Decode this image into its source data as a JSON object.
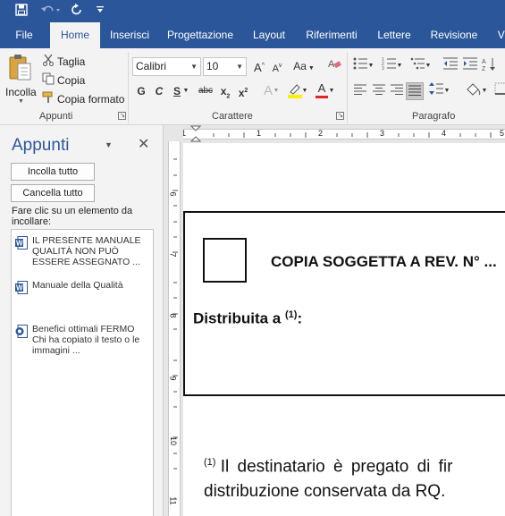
{
  "quick_access": {
    "save_icon": "save-icon",
    "undo_icon": "undo-icon",
    "redo_icon": "redo-icon",
    "customize_icon": "customize-icon"
  },
  "tabs": [
    {
      "label": "File"
    },
    {
      "label": "Home"
    },
    {
      "label": "Inserisci"
    },
    {
      "label": "Progettazione"
    },
    {
      "label": "Layout"
    },
    {
      "label": "Riferimenti"
    },
    {
      "label": "Lettere"
    },
    {
      "label": "Revisione"
    },
    {
      "label": "Vi"
    }
  ],
  "ribbon": {
    "clipboard": {
      "paste": "Incolla",
      "cut": "Taglia",
      "copy": "Copia",
      "format_painter": "Copia formato",
      "group_label": "Appunti"
    },
    "font": {
      "font_name": "Calibri",
      "font_size": "10",
      "grow": "A",
      "shrink": "A",
      "case": "Aa",
      "bold": "G",
      "italic": "C",
      "underline": "S",
      "strike": "abc",
      "subscript": "x",
      "subscript_mark": "2",
      "superscript": "x",
      "superscript_mark": "2",
      "effects": "A",
      "font_color": "A",
      "group_label": "Carattere"
    },
    "paragraph": {
      "group_label": "Paragrafo"
    }
  },
  "pane": {
    "title": "Appunti",
    "paste_all": "Incolla tutto",
    "clear_all": "Cancella tutto",
    "hint": "Fare clic su un elemento da incollare:",
    "items": [
      {
        "text": "IL PRESENTE MANUALE QUALITÀ NON PUÒ ESSERE ASSEGNATO ...",
        "icon": "word-doc-icon"
      },
      {
        "text": "Manuale della Qualità",
        "icon": "word-doc-icon"
      },
      {
        "text": "Benefici ottimali FERMO Chi ha copiato il testo o le immagini ...",
        "icon": "browser-icon"
      }
    ]
  },
  "ruler": {
    "h_numbers": [
      "1",
      "1",
      "2",
      "3",
      "4",
      "5"
    ],
    "v_numbers": [
      "6",
      "7",
      "8",
      "9",
      "10",
      "11"
    ]
  },
  "document": {
    "copy_title": "COPIA SOGGETTA A REV. N° ...",
    "dist_label": "Distribuita a",
    "dist_sup": "(1)",
    "dist_colon": ":",
    "footnote_sup": "(1)",
    "footnote_line1": "Il destinatario è pregato di fir",
    "footnote_line2": "distribuzione conservata da RQ."
  },
  "colors": {
    "brand": "#2b579a",
    "ribbon_bg": "#f3f3f3"
  }
}
